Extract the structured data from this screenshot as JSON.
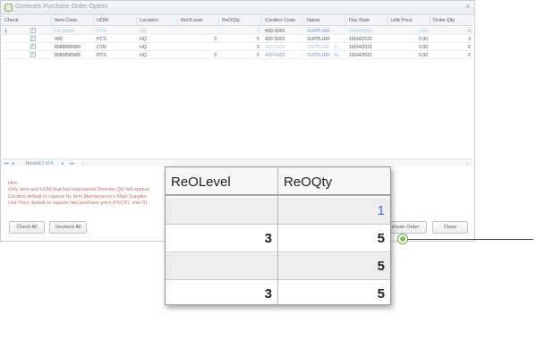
{
  "window": {
    "title": "Generate Purchase Order Option",
    "close_glyph": "×"
  },
  "grid": {
    "columns": [
      "Check",
      "Item Code",
      "UOM",
      "Location",
      "ReOLevel",
      "ReOQty",
      "Creditor Code",
      "Name",
      "Doc Date",
      "Unit Price",
      "Order Qty"
    ],
    "rows": [
      {
        "marker": "‡",
        "check": "✓",
        "item_code": "FG Batch",
        "uom": "PCS",
        "location": "HQ",
        "reolevel": "",
        "reoqty": "1",
        "creditor_code": "400-S001",
        "name": "SUPPLIER",
        "doc_date": "16/04/2021",
        "unit_price": "0.00",
        "order_qty": "2"
      },
      {
        "marker": "",
        "check": "✓",
        "item_code": "999",
        "uom": "PCS",
        "location": "HQ",
        "reolevel": "3",
        "reoqty": "5",
        "creditor_code": "400-S001",
        "name": "SUPPLIER",
        "doc_date": "16/04/2021",
        "unit_price": "0.00",
        "order_qty": "3"
      },
      {
        "marker": "",
        "check": "✓",
        "item_code": "8989898989",
        "uom": "CTN",
        "location": "HQ",
        "reolevel": "",
        "reoqty": "5",
        "creditor_code": "400-S002",
        "name": "SUPPLIER - S...",
        "doc_date": "16/04/2021",
        "unit_price": "0.00",
        "order_qty": "6"
      },
      {
        "marker": "",
        "check": "✓",
        "item_code": "8989898989",
        "uom": "PCS",
        "location": "HQ",
        "reolevel": "3",
        "reoqty": "5",
        "creditor_code": "400-S002",
        "name": "SUPPLIER - S...",
        "doc_date": "16/04/2021",
        "unit_price": "0.00",
        "order_qty": "6"
      }
    ],
    "pager_text": "Record 1 of 4"
  },
  "hint": {
    "title": "Hint:",
    "lines": [
      "Only Item and UOM that had maintained Reorder Qty will appear",
      "Creditor default to capture by Item Maintenance's Main Supplier",
      "Unit Price default to capture last purchase price (PI/CP), else St"
    ]
  },
  "buttons": {
    "check_all": "Check All",
    "uncheck_all": "Uncheck All",
    "purchase_order": "chase Order",
    "close": "Close"
  },
  "zoom": {
    "headers": [
      "ReOLevel",
      "ReOQty"
    ],
    "rows": [
      {
        "reolevel": "",
        "reoqty": "1"
      },
      {
        "reolevel": "3",
        "reoqty": "5"
      },
      {
        "reolevel": "",
        "reoqty": "5"
      },
      {
        "reolevel": "3",
        "reoqty": "5"
      }
    ]
  },
  "colors": {
    "accent_link": "#7d8fd6",
    "hint_red": "#c0726c",
    "pointer_green": "#7ec24a",
    "zoom_value_blue": "#4a6fd8"
  }
}
